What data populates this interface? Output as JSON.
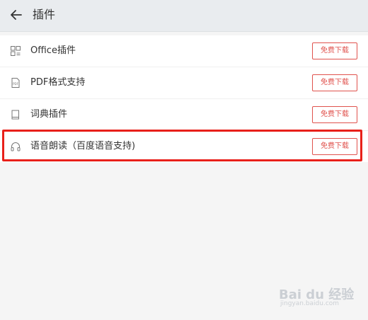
{
  "header": {
    "title": "插件",
    "back_icon": "arrow-left-icon"
  },
  "plugins": [
    {
      "icon": "office-icon",
      "label": "Office插件",
      "button_label": "免费下载"
    },
    {
      "icon": "pdf-icon",
      "label": "PDF格式支持",
      "button_label": "免费下载"
    },
    {
      "icon": "book-icon",
      "label": "词典插件",
      "button_label": "免费下载"
    },
    {
      "icon": "headphones-icon",
      "label": "语音朗读（百度语音支持)",
      "button_label": "免费下载"
    }
  ],
  "colors": {
    "accent": "#e0524d",
    "highlight": "#e8201a",
    "header_bg": "#e9ecef",
    "page_bg": "#f5f5f5"
  },
  "watermark": {
    "text": "Bai du 经验",
    "sub": "jingyan.baidu.com"
  }
}
